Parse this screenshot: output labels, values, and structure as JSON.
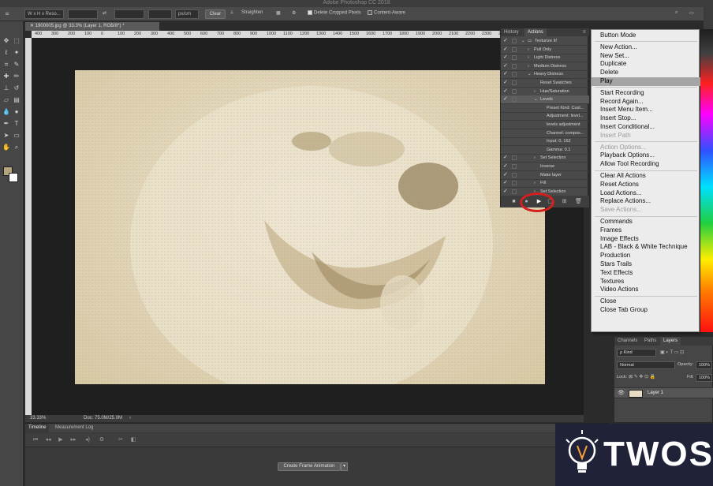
{
  "app": {
    "title": "Adobe Photoshop CC 2018"
  },
  "options_bar": {
    "preset": "W x H x Reso...",
    "unit": "px/cm",
    "clear_label": "Clear",
    "straighten_label": "Straighten",
    "delete_cropped": "Delete Cropped Pixels",
    "content_aware": "Content-Aware"
  },
  "document": {
    "tab_title": "1900005.jpg @ 33.3% (Layer 1, RGB/8*) *",
    "ruler_ticks": [
      "400",
      "300",
      "200",
      "100",
      "0",
      "100",
      "200",
      "300",
      "400",
      "500",
      "600",
      "700",
      "800",
      "900",
      "1000",
      "1100",
      "1200",
      "1300",
      "1400",
      "1500",
      "1600",
      "1700",
      "1800",
      "1900",
      "2000",
      "2100",
      "2200",
      "2300",
      "2400"
    ],
    "zoom": "33.33%",
    "doc_size": "Doc: 75.0M/25.0M"
  },
  "timeline": {
    "tabs": [
      "Timeline",
      "Measurement Log"
    ],
    "create_button": "Create Frame Animation"
  },
  "actions_panel": {
    "tabs": [
      "History",
      "Actions"
    ],
    "rows": [
      {
        "label": "Texturize It!",
        "indent": 0,
        "expanded": true,
        "folder": true
      },
      {
        "label": "Pull Only",
        "indent": 1,
        "expanded": false
      },
      {
        "label": "Light Distress",
        "indent": 1,
        "expanded": false
      },
      {
        "label": "Medium Distress",
        "indent": 1,
        "expanded": false
      },
      {
        "label": "Heavy Distress",
        "indent": 1,
        "expanded": true
      },
      {
        "label": "Reset Swatches",
        "indent": 2,
        "expanded": null
      },
      {
        "label": "Hue/Saturation",
        "indent": 2,
        "expanded": false
      },
      {
        "label": "Levels",
        "indent": 2,
        "expanded": true,
        "selected": true
      },
      {
        "label": "Preset Kind: Cust...",
        "indent": 3,
        "detail": true
      },
      {
        "label": "Adjustment: level...",
        "indent": 3,
        "detail": true
      },
      {
        "label": "levels adjustment",
        "indent": 3,
        "detail": true
      },
      {
        "label": "Channel: compos...",
        "indent": 3,
        "detail": true
      },
      {
        "label": "Input: 0, 162",
        "indent": 3,
        "detail": true
      },
      {
        "label": "Gamma: 0.1",
        "indent": 3,
        "detail": true
      },
      {
        "label": "Set Selection",
        "indent": 2,
        "expanded": false
      },
      {
        "label": "Inverse",
        "indent": 2,
        "expanded": null
      },
      {
        "label": "Make layer",
        "indent": 2,
        "expanded": null
      },
      {
        "label": "Fill",
        "indent": 2,
        "expanded": false
      },
      {
        "label": "Set Selection",
        "indent": 2,
        "expanded": false
      }
    ]
  },
  "flyout_menu": {
    "items": [
      {
        "label": "Button Mode",
        "disabled": false
      },
      {
        "sep": true
      },
      {
        "label": "New Action...",
        "disabled": false
      },
      {
        "label": "New Set...",
        "disabled": false
      },
      {
        "label": "Duplicate",
        "disabled": false
      },
      {
        "label": "Delete",
        "disabled": false
      },
      {
        "label": "Play",
        "disabled": false,
        "highlighted": true
      },
      {
        "sep": true
      },
      {
        "label": "Start Recording",
        "disabled": false
      },
      {
        "label": "Record Again...",
        "disabled": false
      },
      {
        "label": "Insert Menu Item...",
        "disabled": false
      },
      {
        "label": "Insert Stop...",
        "disabled": false
      },
      {
        "label": "Insert Conditional...",
        "disabled": false
      },
      {
        "label": "Insert Path",
        "disabled": true
      },
      {
        "sep": true
      },
      {
        "label": "Action Options...",
        "disabled": true
      },
      {
        "label": "Playback Options...",
        "disabled": false
      },
      {
        "label": "Allow Tool Recording",
        "disabled": false
      },
      {
        "sep": true
      },
      {
        "label": "Clear All Actions",
        "disabled": false
      },
      {
        "label": "Reset Actions",
        "disabled": false
      },
      {
        "label": "Load Actions...",
        "disabled": false
      },
      {
        "label": "Replace Actions...",
        "disabled": false
      },
      {
        "label": "Save Actions...",
        "disabled": true
      },
      {
        "sep": true
      },
      {
        "label": "Commands",
        "disabled": false
      },
      {
        "label": "Frames",
        "disabled": false
      },
      {
        "label": "Image Effects",
        "disabled": false
      },
      {
        "label": "LAB - Black & White Technique",
        "disabled": false
      },
      {
        "label": "Production",
        "disabled": false
      },
      {
        "label": "Stars Trails",
        "disabled": false
      },
      {
        "label": "Text Effects",
        "disabled": false
      },
      {
        "label": "Textures",
        "disabled": false
      },
      {
        "label": "Video Actions",
        "disabled": false
      },
      {
        "sep": true
      },
      {
        "label": "Close",
        "disabled": false
      },
      {
        "label": "Close Tab Group",
        "disabled": false
      }
    ]
  },
  "layers_panel": {
    "tabs": [
      "Channels",
      "Paths",
      "Layers"
    ],
    "kind": "ρ Kind",
    "blend_mode": "Normal",
    "opacity_label": "Opacity:",
    "opacity_value": "100%",
    "lock_label": "Lock:",
    "fill_label": "Fill:",
    "fill_value": "100%",
    "layer_name": "Layer 1"
  },
  "watermark": {
    "text": "TWOS"
  },
  "colors": {
    "highlight": "#a5a5a5",
    "play_circle": "#d41f1f",
    "photo_tint": "#e3d7bb"
  }
}
